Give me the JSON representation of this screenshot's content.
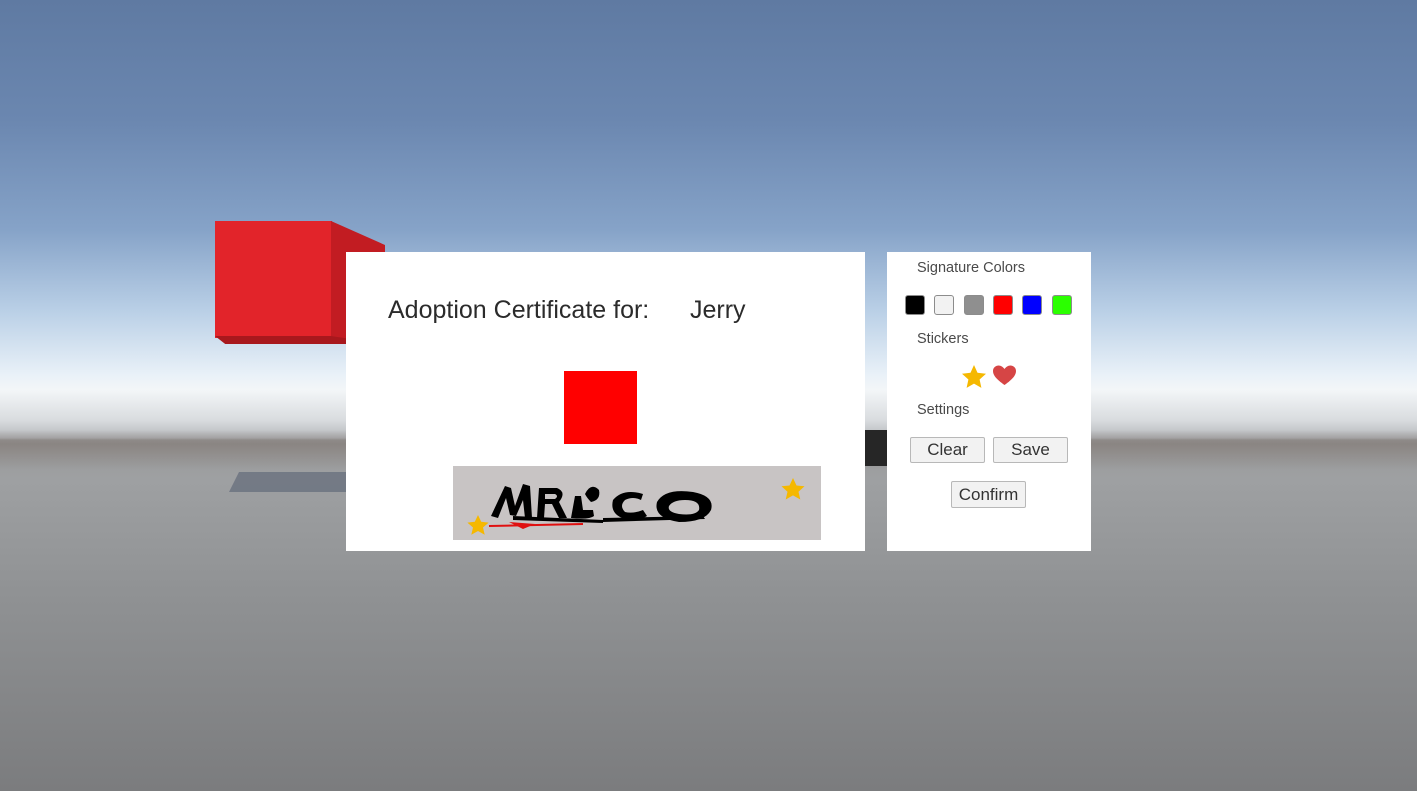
{
  "certificate": {
    "title": "Adoption Certificate for:",
    "pet_name": "Jerry",
    "pet_color": "#ff0000",
    "signature_text": "MRACO"
  },
  "side_panel": {
    "signature_colors_label": "Signature Colors",
    "colors": [
      {
        "name": "black",
        "hex": "#000000"
      },
      {
        "name": "white",
        "hex": "#f2f2f2"
      },
      {
        "name": "gray",
        "hex": "#8f8f8f"
      },
      {
        "name": "red",
        "hex": "#ff0000"
      },
      {
        "name": "blue",
        "hex": "#0000ff"
      },
      {
        "name": "green",
        "hex": "#2bff00"
      }
    ],
    "stickers_label": "Stickers",
    "stickers": [
      {
        "name": "star-icon",
        "color": "#f5b800"
      },
      {
        "name": "heart-icon",
        "color": "#d64545"
      }
    ],
    "settings_label": "Settings",
    "clear_label": "Clear",
    "save_label": "Save",
    "confirm_label": "Confirm"
  },
  "scene": {
    "cube_color": "#e2242a"
  }
}
